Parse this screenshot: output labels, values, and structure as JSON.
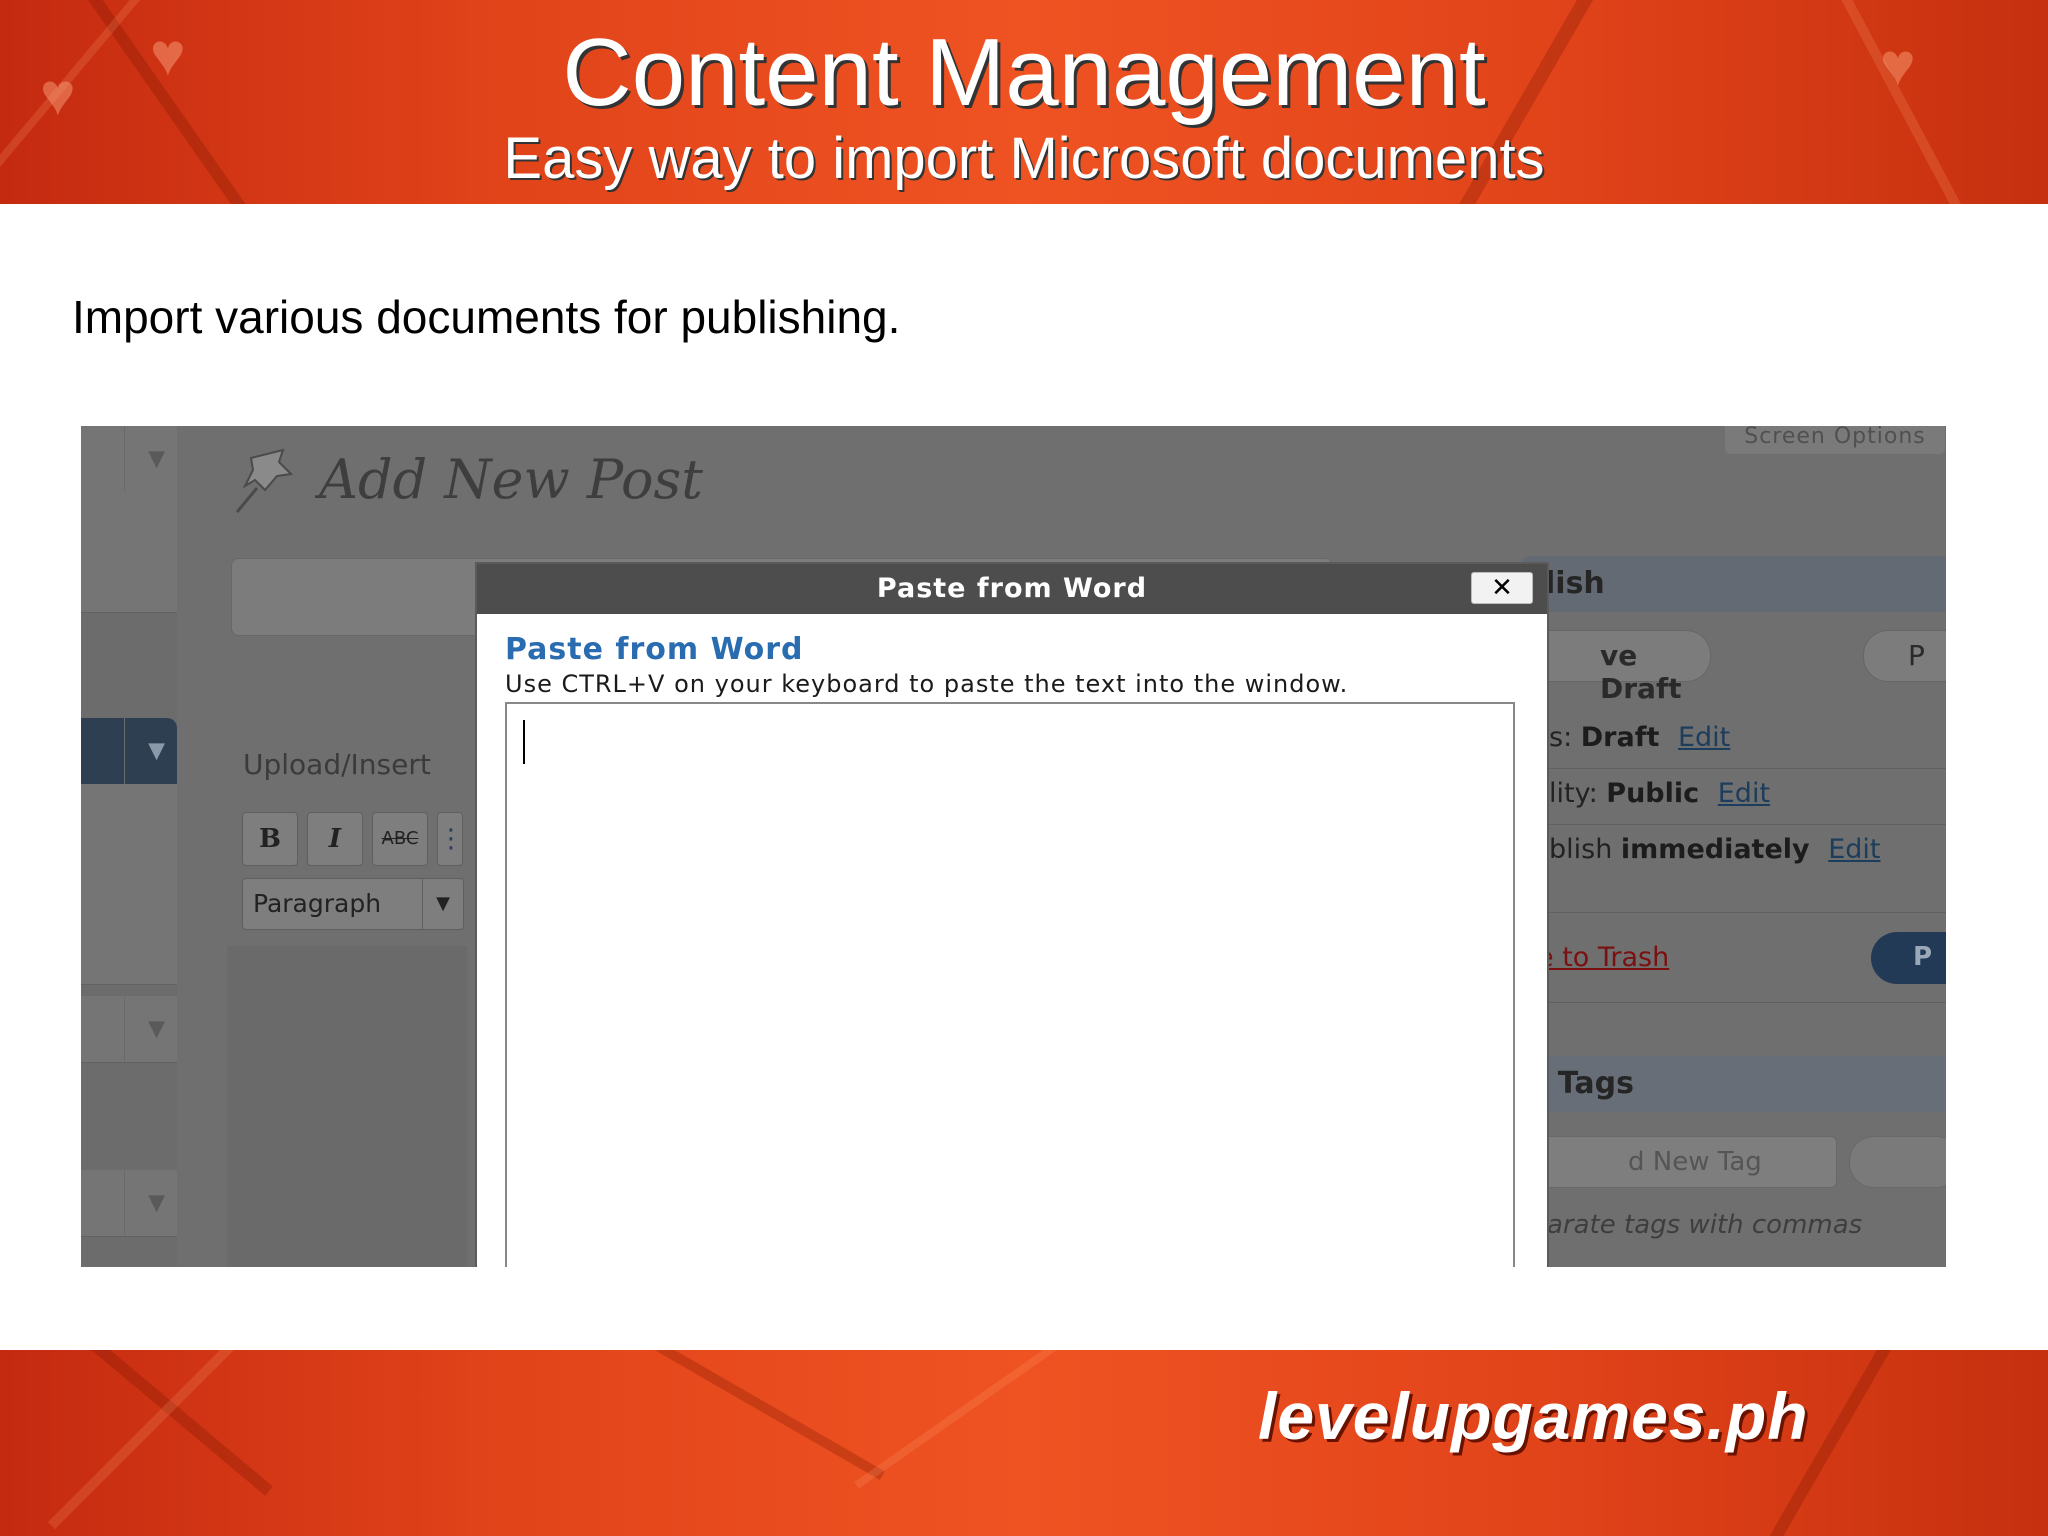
{
  "slide": {
    "title": "Content Management",
    "subtitle": "Easy way to import Microsoft documents",
    "body_text": "Import various documents for publishing.",
    "brand": "levelupgames.ph"
  },
  "wp": {
    "page_heading": "Add New Post",
    "screen_options": "Screen Options",
    "upload_insert": "Upload/Insert",
    "toolbar": {
      "bold": "B",
      "italic": "I",
      "strike": "ABC",
      "format_select": "Paragraph"
    },
    "publish": {
      "title": "lish",
      "save_draft": "ve Draft",
      "preview": "P",
      "status_label": "s:",
      "status_value": "Draft",
      "visibility_label": "lity:",
      "visibility_value": "Public",
      "schedule_label": "blish",
      "schedule_value": "immediately",
      "edit": "Edit",
      "trash": "e to Trash",
      "publish_button": "P"
    },
    "tags": {
      "title": "t Tags",
      "input_placeholder": "d New Tag",
      "hint": "arate tags with commas"
    }
  },
  "modal": {
    "title": "Paste from Word",
    "close": "✕",
    "heading": "Paste from Word",
    "instruction": "Use CTRL+V on your keyboard to paste the text into the window."
  }
}
